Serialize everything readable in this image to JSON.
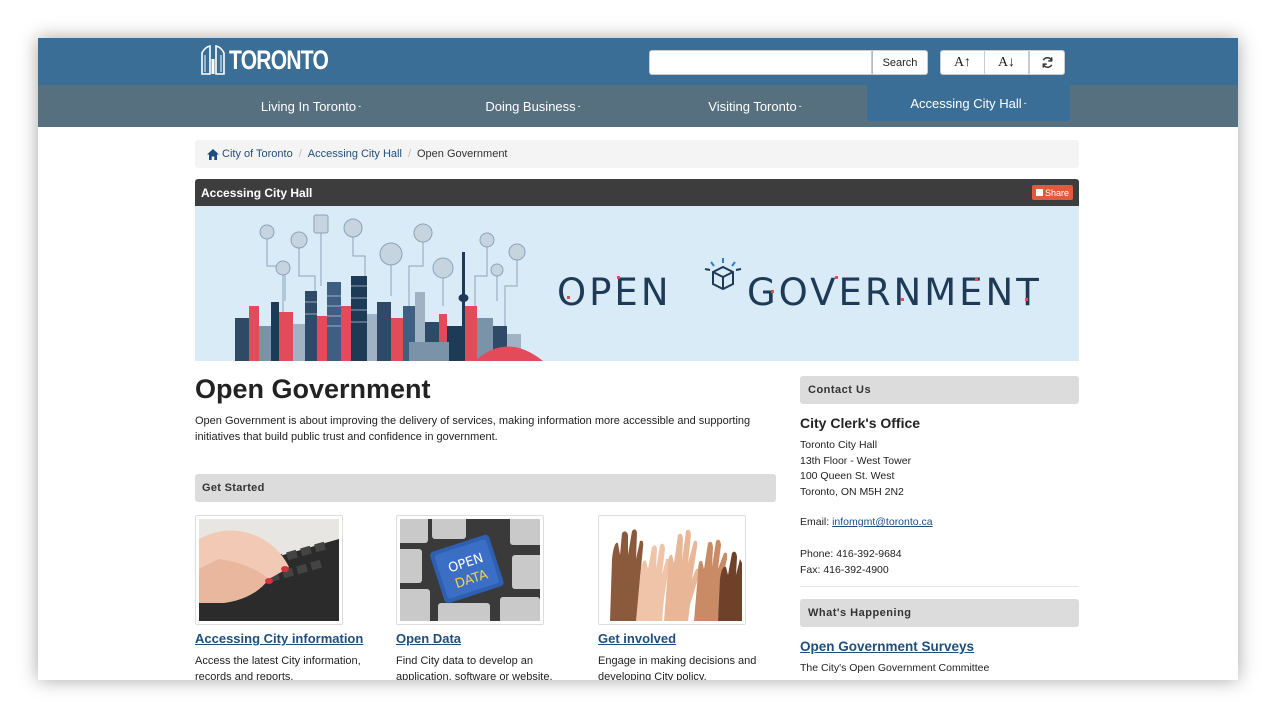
{
  "header": {
    "logo_text": "TORONTO",
    "search_button": "Search",
    "font_up": "A↑",
    "font_down": "A↓",
    "refresh_icon": "refresh-icon"
  },
  "nav": {
    "items": [
      {
        "label": "Living In Toronto"
      },
      {
        "label": "Doing Business"
      },
      {
        "label": "Visiting Toronto"
      },
      {
        "label": "Accessing City Hall",
        "active": true
      }
    ],
    "caret": "-"
  },
  "breadcrumb": {
    "items": [
      "City of Toronto",
      "Accessing City Hall",
      "Open Government"
    ],
    "separator": "/"
  },
  "section": {
    "title": "Accessing City Hall",
    "share": "Share"
  },
  "banner": {
    "title": "OPEN ⬡ GOVERNMENT",
    "left_word": "OPEN",
    "right_word": "GOVERNMENT"
  },
  "main": {
    "title": "Open Government",
    "intro": "Open Government is about improving the delivery of services, making information more accessible and supporting initiatives that build public trust and confidence in government.",
    "get_started": "Get Started",
    "cards": [
      {
        "title": "Accessing City information",
        "desc": "Access the latest City information, records and reports."
      },
      {
        "title": "Open Data",
        "desc": "Find City data to develop an application, software or website.",
        "image_text_1": "OPEN",
        "image_text_2": "DATA"
      },
      {
        "title": "Get involved",
        "desc": "Engage in making decisions and developing City policy."
      }
    ]
  },
  "sidebar": {
    "contact_heading": "Contact Us",
    "office": "City Clerk's Office",
    "address_lines": [
      "Toronto City Hall",
      "13th Floor - West Tower",
      "100 Queen St. West",
      "Toronto, ON M5H 2N2"
    ],
    "email_label": "Email: ",
    "email": "infomgmt@toronto.ca",
    "phone": "Phone: 416-392-9684",
    "fax": "Fax: 416-392-4900",
    "whats_heading": "What's Happening",
    "surveys_title": "Open Government Surveys",
    "surveys_text": "The City's Open Government Committee"
  },
  "colors": {
    "header_blue": "#3a6e96",
    "nav_grey": "#56707f",
    "link_blue": "#1f4e7d",
    "share_red": "#e25a3c",
    "banner_bg": "#d9ebf6"
  }
}
